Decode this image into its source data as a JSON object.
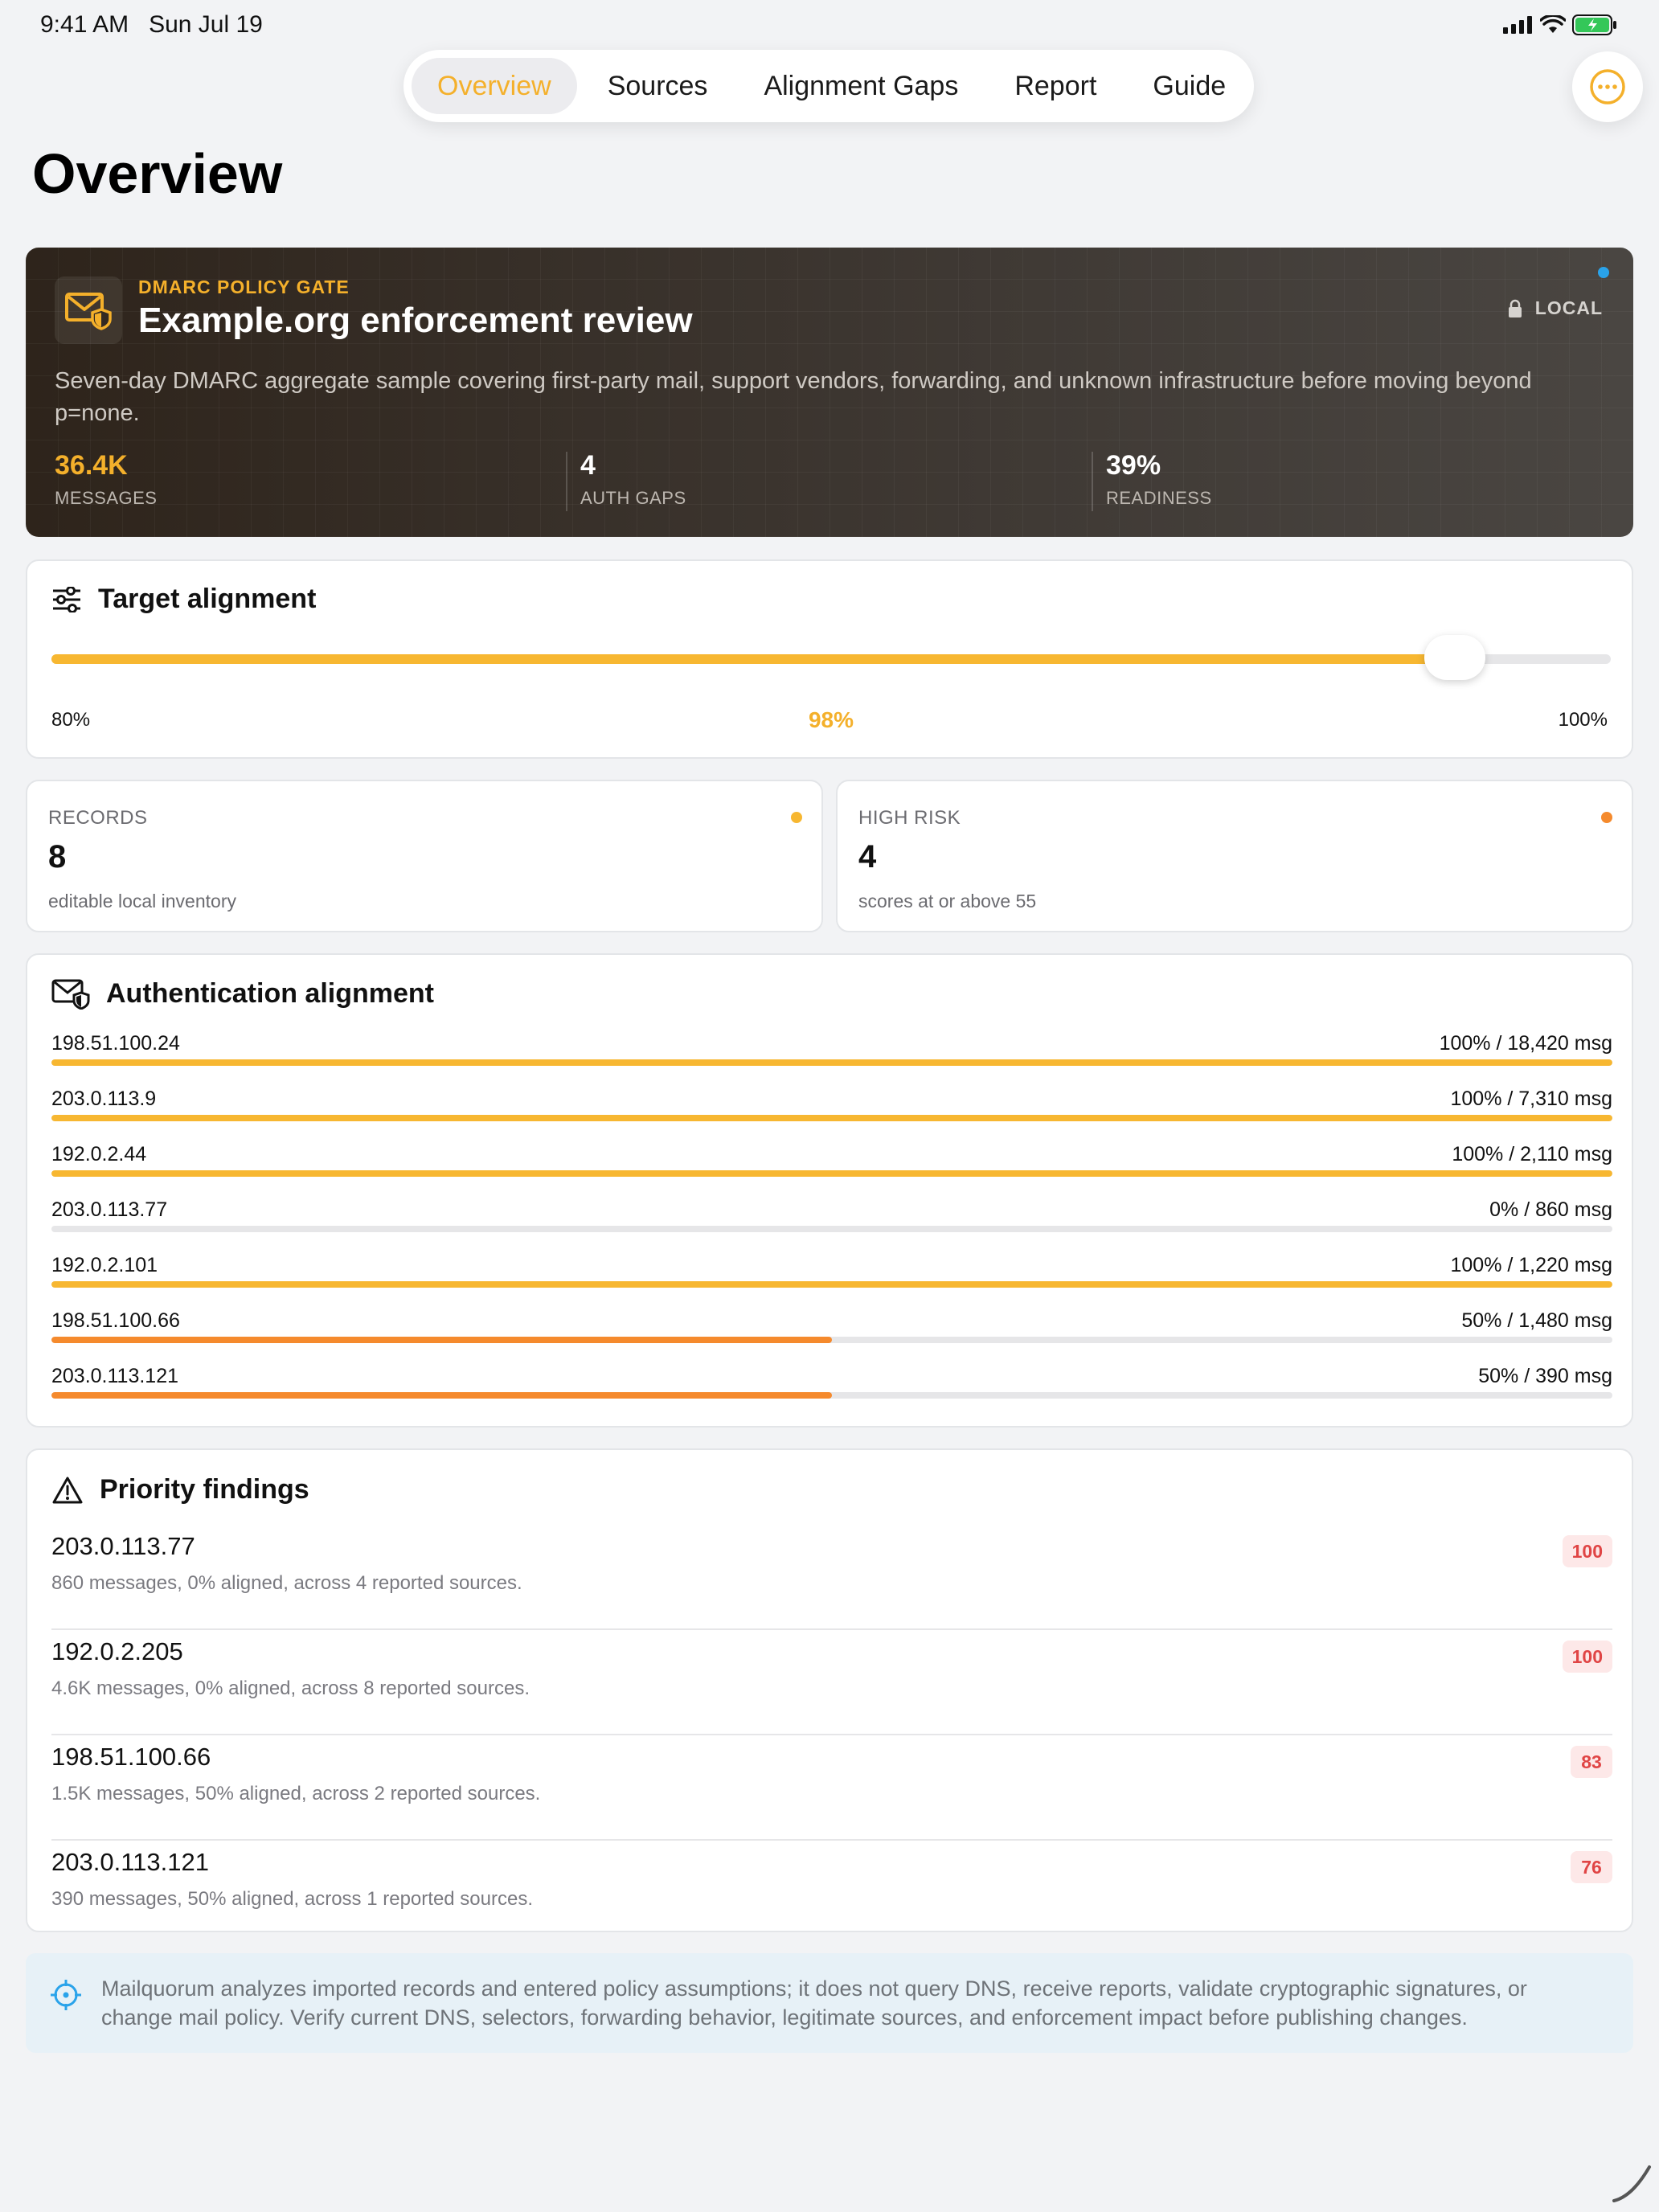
{
  "status_bar": {
    "time": "9:41 AM",
    "date": "Sun Jul 19"
  },
  "tabs": [
    {
      "label": "Overview",
      "active": true
    },
    {
      "label": "Sources",
      "active": false
    },
    {
      "label": "Alignment Gaps",
      "active": false
    },
    {
      "label": "Report",
      "active": false
    },
    {
      "label": "Guide",
      "active": false
    }
  ],
  "page_title": "Overview",
  "hero": {
    "kicker": "DMARC POLICY GATE",
    "title": "Example.org enforcement review",
    "badge": "LOCAL",
    "description": "Seven-day DMARC aggregate sample covering first-party mail, support vendors, forwarding, and unknown infrastructure before moving beyond p=none.",
    "stats": [
      {
        "value": "36.4K",
        "label": "MESSAGES"
      },
      {
        "value": "4",
        "label": "AUTH GAPS"
      },
      {
        "value": "39%",
        "label": "READINESS"
      }
    ]
  },
  "target_alignment": {
    "title": "Target alignment",
    "min_label": "80%",
    "max_label": "100%",
    "value_label": "98%",
    "value_fraction": 0.9
  },
  "stat_cards": [
    {
      "label": "RECORDS",
      "value": "8",
      "sub": "editable local inventory",
      "dot_color": "#f7b731"
    },
    {
      "label": "HIGH RISK",
      "value": "4",
      "sub": "scores at or above 55",
      "dot_color": "#f58a2d"
    }
  ],
  "auth_alignment": {
    "title": "Authentication alignment",
    "rows": [
      {
        "ip": "198.51.100.24",
        "value": "100% / 18,420 msg",
        "pct": 100
      },
      {
        "ip": "203.0.113.9",
        "value": "100% / 7,310 msg",
        "pct": 100
      },
      {
        "ip": "192.0.2.44",
        "value": "100% / 2,110 msg",
        "pct": 100
      },
      {
        "ip": "203.0.113.77",
        "value": "0% / 860 msg",
        "pct": 0
      },
      {
        "ip": "192.0.2.101",
        "value": "100% / 1,220 msg",
        "pct": 100
      },
      {
        "ip": "198.51.100.66",
        "value": "50% / 1,480 msg",
        "pct": 50
      },
      {
        "ip": "203.0.113.121",
        "value": "50% / 390 msg",
        "pct": 50
      }
    ]
  },
  "priority_findings": {
    "title": "Priority findings",
    "items": [
      {
        "ip": "203.0.113.77",
        "desc": "860 messages, 0% aligned, across 4 reported sources.",
        "score": "100"
      },
      {
        "ip": "192.0.2.205",
        "desc": "4.6K messages, 0% aligned, across 8 reported sources.",
        "score": "100"
      },
      {
        "ip": "198.51.100.66",
        "desc": "1.5K messages, 50% aligned, across 2 reported sources.",
        "score": "83"
      },
      {
        "ip": "203.0.113.121",
        "desc": "390 messages, 50% aligned, across 1 reported sources.",
        "score": "76"
      }
    ]
  },
  "notice": "Mailquorum analyzes imported records and entered policy assumptions; it does not query DNS, receive reports, validate cryptographic signatures, or change mail policy. Verify current DNS, selectors, forwarding behavior, legitimate sources, and enforcement impact before publishing changes.",
  "colors": {
    "accent": "#f4b02b",
    "warning": "#f58a2d",
    "danger": "#e04545",
    "info": "#2aa3ea"
  }
}
